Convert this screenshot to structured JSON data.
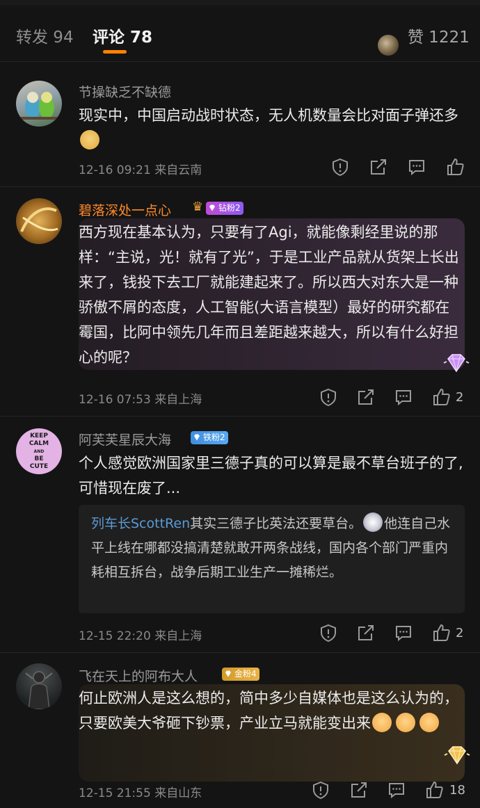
{
  "tabs": {
    "repost": "转发 94",
    "comments": "评论 78",
    "likes": "赞 1221"
  },
  "comments": [
    {
      "name": "节操缺乏不缺德",
      "text": "现实中，中国启动战时状态，无人机数量会比对面子弹还多",
      "time": "12-16 09:21 来自云南",
      "likes": ""
    },
    {
      "name": "碧落深处一点心",
      "badge": "钻粉2",
      "text": "西方现在基本认为，只要有了Agi，就能像剩经里说的那样：“主说，光！就有了光”，于是工业产品就从货架上长出来了，钱投下去工厂就能建起来了。所以西大对东大是一种骄傲不屑的态度，人工智能(大语言模型）最好的研究都在霉国，比阿中领先几年而且差距越来越大，所以有什么好担心的呢？",
      "time": "12-16 07:53 来自上海",
      "likes": "2"
    },
    {
      "name": "阿芙芙星辰大海",
      "badge": "铁粉2",
      "avatar_text": [
        "KEEP",
        "CALM",
        "AND",
        "BE",
        "CUTE"
      ],
      "text": "个人感觉欧洲国家里三德子真的可以算是最不草台班子的了, 可惜现在废了...",
      "reply_author": "列车长ScottRen",
      "reply_text": "其实三德子比英法还要草台。",
      "reply_text2": "他连自己水平上线在哪都没搞清楚就敢开两条战线，国内各个部门严重内耗相互拆台，战争后期工业生产一摊稀烂。",
      "time": "12-15 22:20 来自上海",
      "likes": "2"
    },
    {
      "name": "飞在天上的阿布大人",
      "badge": "金粉4",
      "text": "何止欧洲人是这么想的，简中多少自媒体也是这么认为的，只要欧美大爷砸下钞票，产业立马就能变出来",
      "time": "12-15 21:55 来自山东",
      "likes": "18"
    }
  ],
  "icons": {
    "report": "report-icon",
    "share": "share-icon",
    "reply": "comment-icon",
    "like": "thumbs-up-icon"
  },
  "colors": {
    "accent": "#ff8200",
    "background": "#141414",
    "link": "#5b9bd5"
  }
}
